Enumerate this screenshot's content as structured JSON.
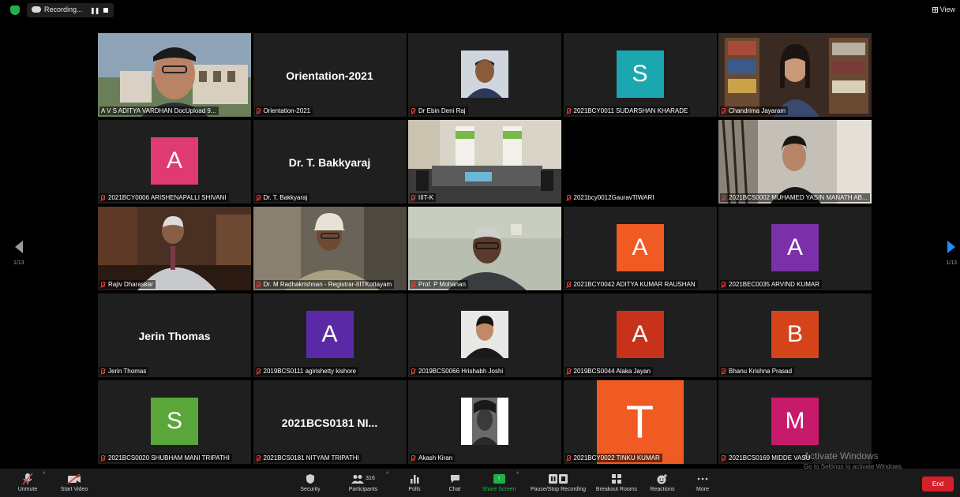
{
  "topbar": {
    "recording_label": "Recording...",
    "pause_glyph": "❚❚",
    "view_label": "View"
  },
  "tiles": [
    {
      "name": "A V S ADITYA VARDHAN DocUpload 9...",
      "type": "video",
      "active": true
    },
    {
      "name": "Orientation-2021",
      "type": "name",
      "display": "Orientation-2021"
    },
    {
      "name": "Dr Ebin Deni Raj",
      "type": "photo"
    },
    {
      "name": "2021BCY0011 SUDARSHAN KHARADE",
      "type": "avatar",
      "letter": "S",
      "color": "#1ba7b0"
    },
    {
      "name": "Chandrima Jayaram",
      "type": "video"
    },
    {
      "name": "2021BCY0006 ARISHENAPALLI SHIVANI",
      "type": "avatar",
      "letter": "A",
      "color": "#e03a72"
    },
    {
      "name": "Dr. T. Bakkyaraj",
      "type": "name",
      "display": "Dr. T. Bakkyaraj"
    },
    {
      "name": "IIIT-K",
      "type": "video"
    },
    {
      "name": "2021bcy0012GauravTIWARI",
      "type": "blank"
    },
    {
      "name": "2021BCS0002 MUHAMED YASIN MANATH AB...",
      "type": "video"
    },
    {
      "name": "Rajiv Dharaskar",
      "type": "video"
    },
    {
      "name": "Dr. M Radhakrishnan - Registrar-IIITKottayam",
      "type": "video"
    },
    {
      "name": "Prof. P Mohanan",
      "type": "video"
    },
    {
      "name": "2021BCY0042 ADITYA KUMAR RAUSHAN",
      "type": "avatar",
      "letter": "A",
      "color": "#f05a23"
    },
    {
      "name": "2021BEC0035 ARVIND KUMAR",
      "type": "avatar",
      "letter": "A",
      "color": "#7b2fa8"
    },
    {
      "name": "Jerin Thomas",
      "type": "name",
      "display": "Jerin Thomas"
    },
    {
      "name": "2019BCS0111 agirishetty kishore",
      "type": "avatar",
      "letter": "A",
      "color": "#5a2aa6"
    },
    {
      "name": "2019BCS0066 Hrishabh Joshi",
      "type": "photo"
    },
    {
      "name": "2019BCS0044 Alaka Jayan",
      "type": "avatar",
      "letter": "A",
      "color": "#c8321a"
    },
    {
      "name": "Bhanu Krishna Prasad",
      "type": "avatar",
      "letter": "B",
      "color": "#d4431a"
    },
    {
      "name": "2021BCS0020 SHUBHAM MANI TRIPATHI",
      "type": "avatar",
      "letter": "S",
      "color": "#5aa63a"
    },
    {
      "name": "2021BCS0181 NITYAM TRIPATHI",
      "type": "name",
      "display": "2021BCS0181 NI..."
    },
    {
      "name": "Akash Kiran",
      "type": "photo"
    },
    {
      "name": "2021BCY0022 TINKU KUMAR",
      "type": "bigavatar",
      "letter": "T",
      "color": "#f05a23"
    },
    {
      "name": "2021BCS0169 MIDDE VASU",
      "type": "avatar",
      "letter": "M",
      "color": "#c81a6b"
    }
  ],
  "pagination": {
    "left": "1/13",
    "right": "1/13"
  },
  "toolbar": {
    "unmute": "Unmute",
    "start_video": "Start Video",
    "security": "Security",
    "participants": "Participants",
    "participants_count": "316",
    "polls": "Polls",
    "chat": "Chat",
    "share_screen": "Share Screen",
    "recording": "Pause/Stop Recording",
    "breakout": "Breakout Rooms",
    "reactions": "Reactions",
    "more": "More",
    "end": "End"
  },
  "watermark": {
    "line1": "Activate Windows",
    "line2": "Go to Settings to activate Windows."
  },
  "colors": {
    "accent": "#1c8fff",
    "active_speaker": "#9fd64a",
    "share": "#21b04a",
    "end": "#d5202a",
    "muted": "#e23d3d"
  }
}
